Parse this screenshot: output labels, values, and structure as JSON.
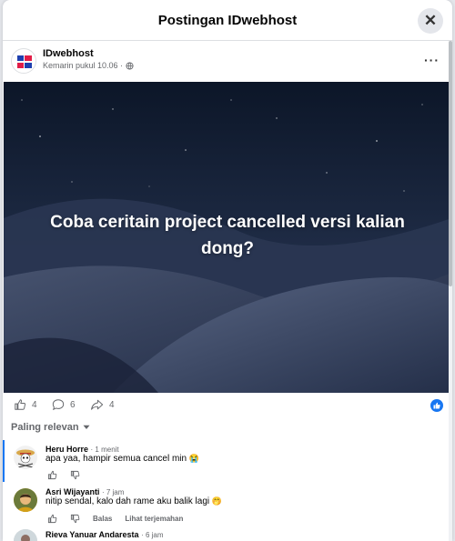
{
  "modal": {
    "title": "Postingan IDwebhost",
    "close_label": "✕"
  },
  "post": {
    "page_name": "IDwebhost",
    "time": "Kemarin pukul 10.06 ·",
    "more": "···",
    "image_text": "Coba ceritain project cancelled versi kalian dong?",
    "likes": "4",
    "comments": "6",
    "shares": "4"
  },
  "sort": {
    "label": "Paling relevan"
  },
  "comments": [
    {
      "name": "Heru Horre",
      "time": "· 1 menit",
      "text": "apa yaa, hampir semua cancel min",
      "emoji": "😭",
      "reply": "",
      "translate": ""
    },
    {
      "name": "Asri Wijayanti",
      "time": "· 7 jam",
      "text": "nitip sendal, kalo dah rame aku balik lagi",
      "emoji": "🤭",
      "reply": "Balas",
      "translate": "Lihat terjemahan"
    },
    {
      "name": "Rieva Yanuar Andaresta",
      "time": "· 6 jam",
      "text": "",
      "emoji": "",
      "reply": "",
      "translate": ""
    }
  ],
  "colors": {
    "accent": "#1877f2",
    "sky_top": "#0d1a2e",
    "sky_bottom": "#2b3a56",
    "dune": "#3a4660"
  }
}
